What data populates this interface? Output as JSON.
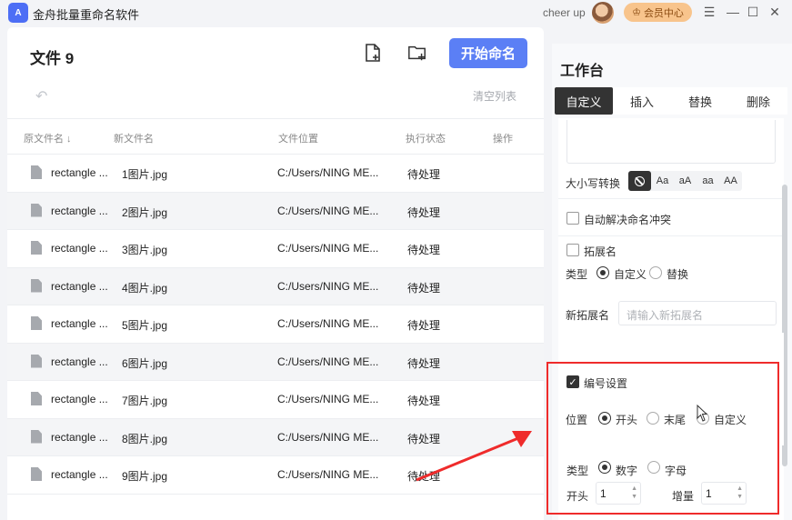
{
  "app": {
    "title": "金舟批量重命名软件",
    "logo_text": "A",
    "user": "cheer up",
    "vip_label": "会员中心"
  },
  "toolbar": {
    "files_title": "文件 9",
    "start_label": "开始命名",
    "clear_label": "清空列表"
  },
  "table": {
    "headers": [
      "原文件名",
      "新文件名",
      "文件位置",
      "执行状态",
      "操作"
    ],
    "rows": [
      {
        "orig": "rectangle ...",
        "new": "1图片.jpg",
        "path": "C:/Users/NING ME...",
        "status": "待处理"
      },
      {
        "orig": "rectangle ...",
        "new": "2图片.jpg",
        "path": "C:/Users/NING ME...",
        "status": "待处理"
      },
      {
        "orig": "rectangle ...",
        "new": "3图片.jpg",
        "path": "C:/Users/NING ME...",
        "status": "待处理"
      },
      {
        "orig": "rectangle ...",
        "new": "4图片.jpg",
        "path": "C:/Users/NING ME...",
        "status": "待处理"
      },
      {
        "orig": "rectangle ...",
        "new": "5图片.jpg",
        "path": "C:/Users/NING ME...",
        "status": "待处理"
      },
      {
        "orig": "rectangle ...",
        "new": "6图片.jpg",
        "path": "C:/Users/NING ME...",
        "status": "待处理"
      },
      {
        "orig": "rectangle ...",
        "new": "7图片.jpg",
        "path": "C:/Users/NING ME...",
        "status": "待处理"
      },
      {
        "orig": "rectangle ...",
        "new": "8图片.jpg",
        "path": "C:/Users/NING ME...",
        "status": "待处理"
      },
      {
        "orig": "rectangle ...",
        "new": "9图片.jpg",
        "path": "C:/Users/NING ME...",
        "status": "待处理"
      }
    ]
  },
  "workbench": {
    "title": "工作台",
    "tabs": [
      "自定义",
      "插入",
      "替换",
      "删除"
    ],
    "case_label": "大小写转换",
    "case_options": [
      "⃠",
      "Aa",
      "aA",
      "aa",
      "AA"
    ],
    "auto_resolve": "自动解决命名冲突",
    "extension": "拓展名",
    "type_label": "类型",
    "ext_custom": "自定义",
    "ext_replace": "替换",
    "new_ext_label": "新拓展名",
    "new_ext_placeholder": "请输入新拓展名",
    "numbering": "编号设置",
    "position_label": "位置",
    "pos_start": "开头",
    "pos_end": "末尾",
    "pos_custom": "自定义",
    "num_type_label": "类型",
    "type_number": "数字",
    "type_letter": "字母",
    "start_label": "开头",
    "start_value": "1",
    "increment_label": "增量",
    "increment_value": "1"
  },
  "colors": {
    "accent": "#5b7ff5",
    "highlight": "#ef2b2b",
    "vip": "#f8c48c"
  }
}
